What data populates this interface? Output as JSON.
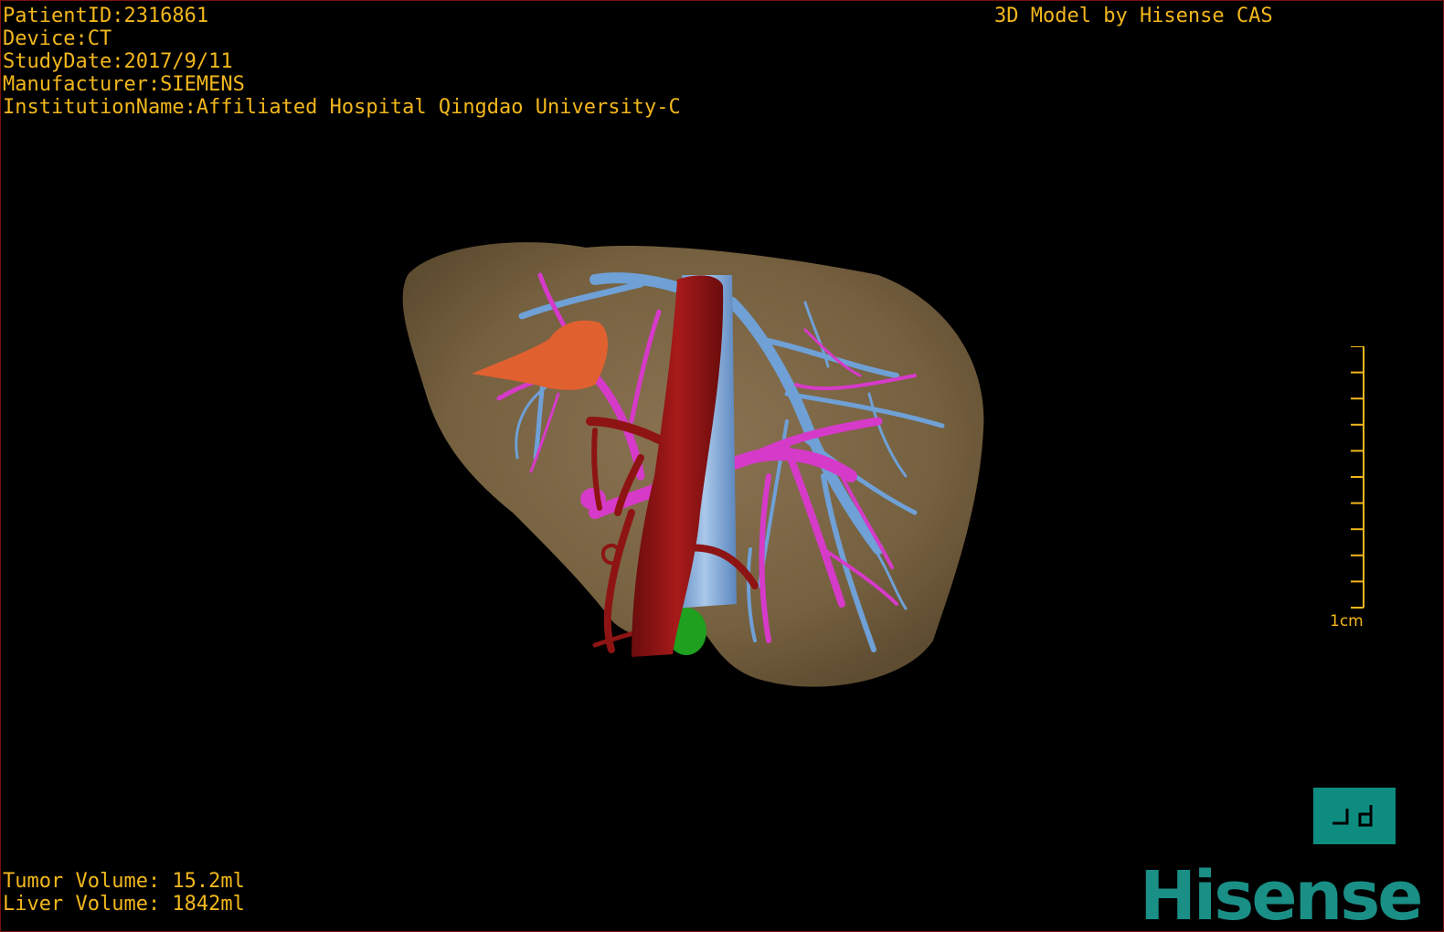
{
  "patient": {
    "id_line": "PatientID:2316861",
    "device_line": "Device:CT",
    "study_date_line": "StudyDate:2017/9/11",
    "manufacturer_line": "Manufacturer:SIEMENS",
    "institution_line": "InstitutionName:Affiliated Hospital Qingdao University-C"
  },
  "header": {
    "credit": "3D Model by Hisense CAS"
  },
  "volumes": {
    "tumor": "Tumor Volume: 15.2ml",
    "liver": "Liver Volume: 1842ml"
  },
  "scale": {
    "label": "1cm"
  },
  "view_button": {
    "icon": "orthographic-view-icon"
  },
  "brand": {
    "text": "Hisense"
  },
  "colors": {
    "overlay_text": "#f2b71c",
    "liver": "#7d6645",
    "hepatic_vein": "#6fa0d6",
    "portal_vein": "#d63ac8",
    "artery": "#8e1414",
    "tumor": "#e06030",
    "gallbladder": "#1fa01f",
    "brand": "#1a8f86"
  }
}
